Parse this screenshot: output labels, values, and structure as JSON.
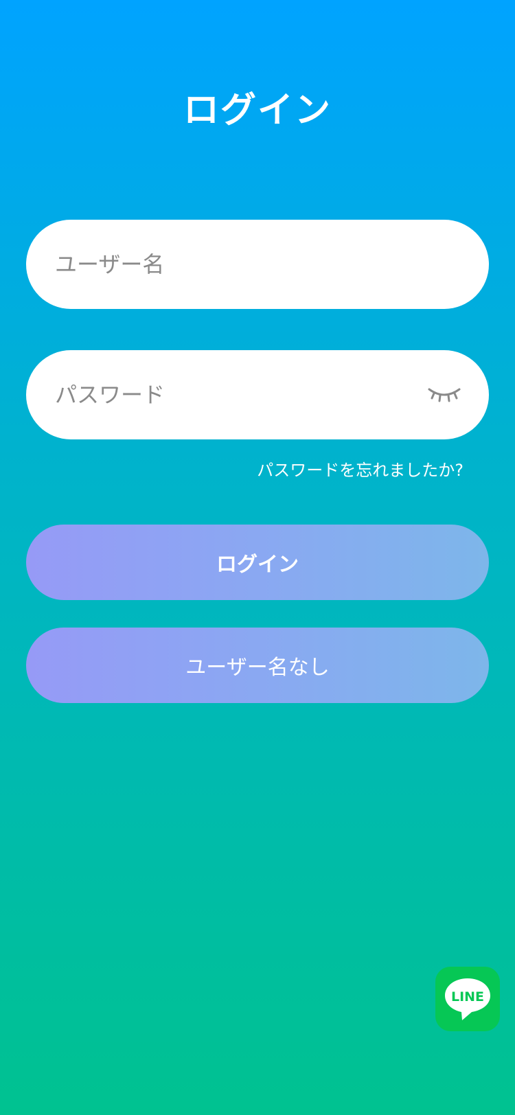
{
  "page": {
    "title": "ログイン"
  },
  "form": {
    "username_placeholder": "ユーザー名",
    "password_placeholder": "パスワード",
    "password_toggle_icon": "eye-closed-icon",
    "forgot_password": "パスワードを忘れましたか?"
  },
  "buttons": {
    "login": "ログイン",
    "no_username": "ユーザー名なし"
  },
  "line": {
    "label": "LINE",
    "icon": "line-chat-icon"
  },
  "colors": {
    "bg_top": "#00a3ff",
    "bg_bottom": "#00c290",
    "button_left": "#969af6",
    "button_right": "#7db6ea",
    "line_green": "#06c755"
  }
}
